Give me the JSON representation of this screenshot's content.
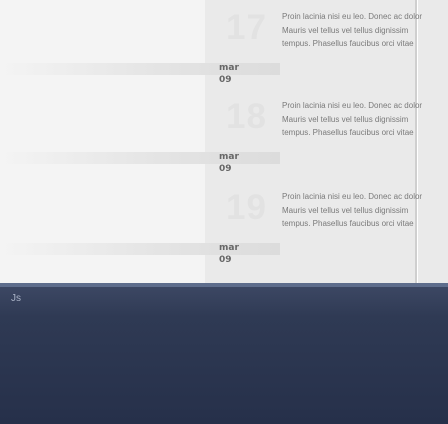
{
  "entries": [
    {
      "day": "17",
      "month": "mar 09",
      "text": "Proin lacinia nisi eu leo. Donec ac dolor Mauris vel tellus vel tellus dignissim tempus. Phasellus faucibus orci vitae"
    },
    {
      "day": "18",
      "month": "mar 09",
      "text": "Proin lacinia nisi eu leo. Donec ac dolor Mauris vel tellus vel tellus dignissim tempus. Phasellus faucibus orci vitae"
    },
    {
      "day": "19",
      "month": "mar 09",
      "text": "Proin lacinia nisi eu leo. Donec ac dolor Mauris vel tellus vel tellus dignissim tempus. Phasellus faucibus orci vitae"
    }
  ],
  "footer": {
    "label": "Js"
  },
  "colors": {
    "panel_bg": "#f4f4f4",
    "footer_bg": "#2f3a54"
  }
}
